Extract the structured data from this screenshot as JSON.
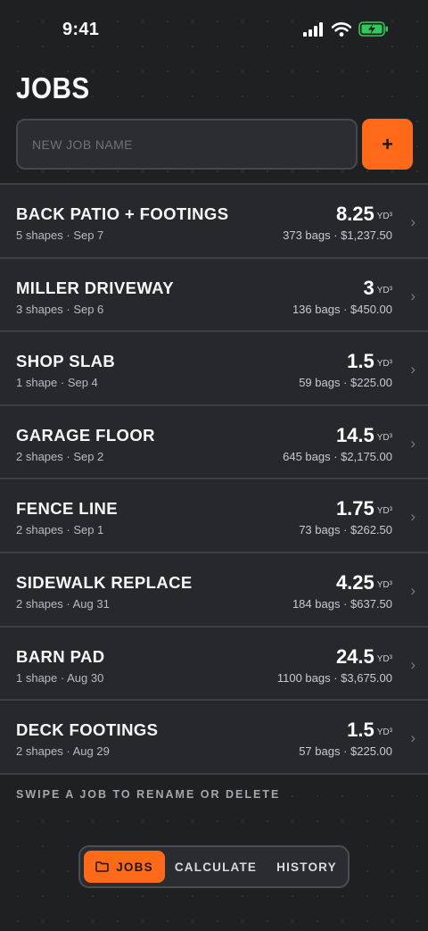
{
  "status": {
    "time": "9:41"
  },
  "title": "JOBS",
  "new_job": {
    "placeholder": "NEW JOB NAME",
    "add_label": "+"
  },
  "jobs": [
    {
      "name": "BACK PATIO + FOOTINGS",
      "meta": "5 shapes · Sep 7",
      "volume": "8.25",
      "unit": "YD³",
      "cost": "373 bags · $1,237.50"
    },
    {
      "name": "MILLER DRIVEWAY",
      "meta": "3 shapes · Sep 6",
      "volume": "3",
      "unit": "YD³",
      "cost": "136 bags · $450.00"
    },
    {
      "name": "SHOP SLAB",
      "meta": "1 shape · Sep 4",
      "volume": "1.5",
      "unit": "YD³",
      "cost": "59 bags · $225.00"
    },
    {
      "name": "GARAGE FLOOR",
      "meta": "2 shapes · Sep 2",
      "volume": "14.5",
      "unit": "YD³",
      "cost": "645 bags · $2,175.00"
    },
    {
      "name": "FENCE LINE",
      "meta": "2 shapes · Sep 1",
      "volume": "1.75",
      "unit": "YD³",
      "cost": "73 bags · $262.50"
    },
    {
      "name": "SIDEWALK REPLACE",
      "meta": "2 shapes · Aug 31",
      "volume": "4.25",
      "unit": "YD³",
      "cost": "184 bags · $637.50"
    },
    {
      "name": "BARN PAD",
      "meta": "1 shape · Aug 30",
      "volume": "24.5",
      "unit": "YD³",
      "cost": "1100 bags · $3,675.00"
    },
    {
      "name": "DECK FOOTINGS",
      "meta": "2 shapes · Aug 29",
      "volume": "1.5",
      "unit": "YD³",
      "cost": "57 bags · $225.00"
    }
  ],
  "hint": "SWIPE A JOB TO RENAME OR DELETE",
  "tabs": {
    "jobs": "JOBS",
    "calculate": "CALCULATE",
    "history": "HISTORY"
  },
  "colors": {
    "accent": "#ff6a1a",
    "background": "#1f2022",
    "row": "#26282b"
  },
  "icons": [
    "cellular-signal-icon",
    "wifi-icon",
    "battery-charging-icon",
    "plus-icon",
    "chevron-right-icon",
    "folder-icon"
  ]
}
